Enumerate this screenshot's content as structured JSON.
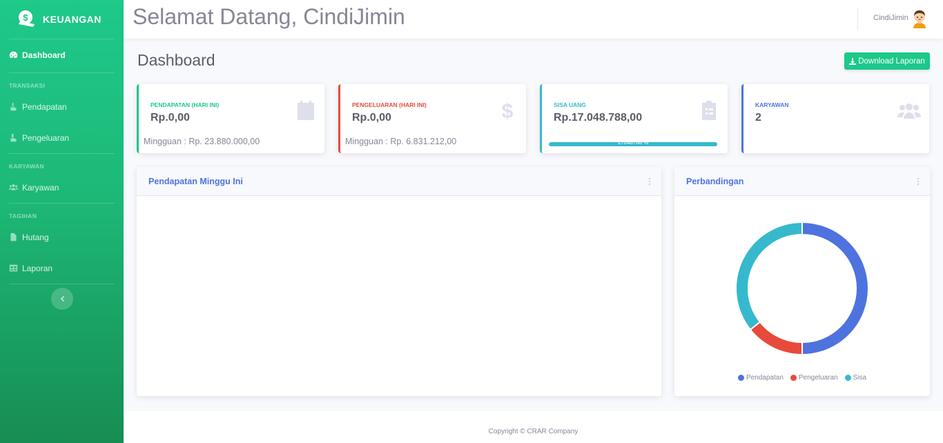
{
  "sidebar": {
    "brand": "KEUANGAN",
    "dashboard": "Dashboard",
    "headings": {
      "transaksi": "TRANSAKSI",
      "karyawan": "KARYAWAN",
      "tagihan": "TAGIHAN"
    },
    "items": {
      "pendapatan": "Pendapatan",
      "pengeluaran": "Pengeluaran",
      "karyawan": "Karyawan",
      "hutang": "Hutang",
      "laporan": "Laporan"
    }
  },
  "topbar": {
    "welcome": "Selamat Datang, CindiJimin",
    "user": "CindiJimin"
  },
  "page": {
    "title": "Dashboard",
    "download": "Download Laporan"
  },
  "cards": {
    "pendapatan": {
      "label": "PENDAPATAN (HARI INI)",
      "value": "Rp.0,00",
      "sub": "Mingguan : Rp. 23.880.000,00",
      "color": "#1cc88a",
      "icon": "calendar-icon"
    },
    "pengeluaran": {
      "label": "PENGELUARAN (HARI INI)",
      "value": "Rp.0,00",
      "sub": "Mingguan : Rp. 6.831.212,00",
      "color": "#e74a3b",
      "icon": "dollar-icon"
    },
    "sisa": {
      "label": "SISA UANG",
      "value": "Rp.17.048.788,00",
      "progress_text": "17048788 %",
      "progress": 100,
      "color": "#36b9cc",
      "icon": "clipboard-list-icon"
    },
    "karyawan": {
      "label": "KARYAWAN",
      "value": "2",
      "color": "#4e73df",
      "icon": "users-icon"
    }
  },
  "panels": {
    "weekly": "Pendapatan Minggu Ini",
    "comparison": "Perbandingan"
  },
  "chart_data": {
    "type": "pie",
    "categories": [
      "Pendapatan",
      "Pengeluaran",
      "Sisa"
    ],
    "values": [
      23880000,
      6831212,
      17048788
    ],
    "colors": [
      "#4e73df",
      "#e74a3b",
      "#36b9cc"
    ],
    "legend": "bottom"
  },
  "footer": {
    "copyright": "Copyright © CRAR Company"
  }
}
